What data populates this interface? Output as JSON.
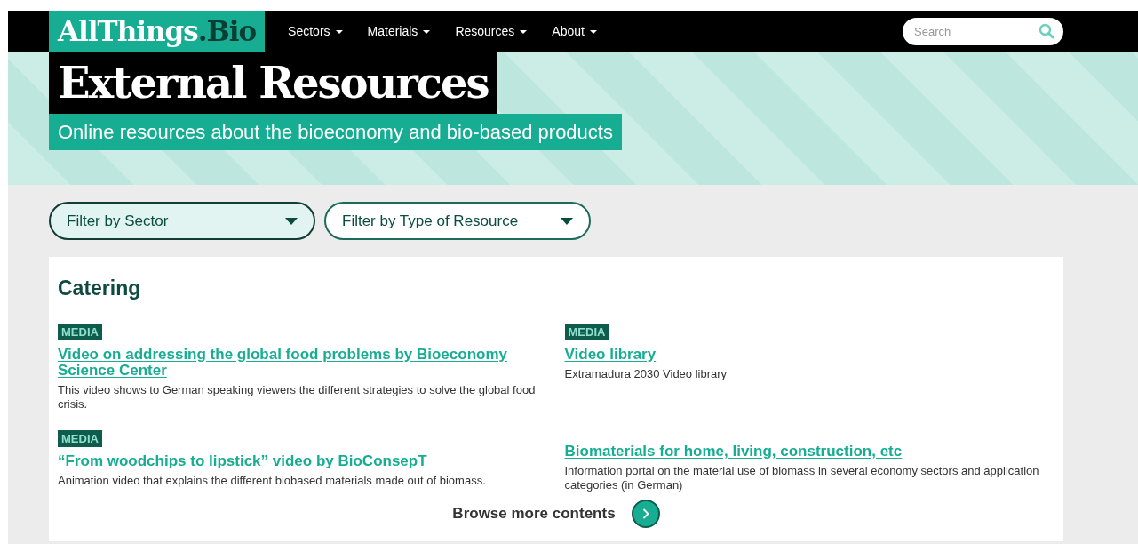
{
  "logo": {
    "main": "AllThings",
    "suffix": ".Bio"
  },
  "nav": [
    {
      "label": "Sectors"
    },
    {
      "label": "Materials"
    },
    {
      "label": "Resources"
    },
    {
      "label": "About"
    }
  ],
  "search": {
    "placeholder": "Search"
  },
  "hero": {
    "title": "External Resources",
    "subtitle": "Online resources about the bioeconomy and bio-based products"
  },
  "filters": [
    {
      "label": "Filter by Sector",
      "selected": true
    },
    {
      "label": "Filter by Type of Resource",
      "selected": false
    }
  ],
  "section": {
    "heading": "Catering",
    "items": [
      {
        "tag": "MEDIA",
        "title": "Video on addressing the global food problems by Bioeconomy Science Center",
        "description": "This video shows to German speaking viewers the different strategies to solve the global food crisis."
      },
      {
        "tag": "MEDIA",
        "title": "Video library",
        "description": "Extramadura 2030 Video library"
      },
      {
        "tag": "MEDIA",
        "title": "“From woodchips to lipstick” video by BioConsepT",
        "description": "Animation video that explains the different biobased materials made out of biomass."
      },
      {
        "title": "Biomaterials for home, living, construction, etc",
        "description": "Information portal on the material use of biomass in several economy sectors and application categories (in German)"
      }
    ],
    "browse": "Browse more contents"
  }
}
